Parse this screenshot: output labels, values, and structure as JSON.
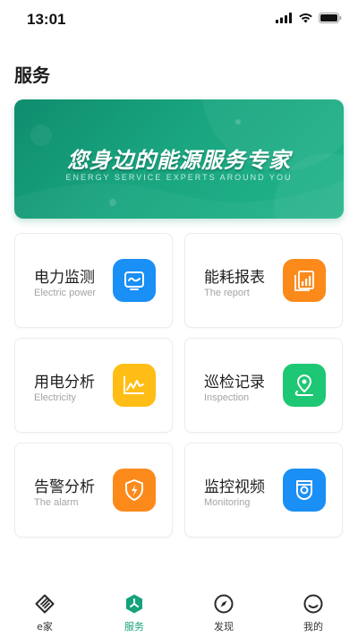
{
  "status_bar": {
    "time": "13:01"
  },
  "page": {
    "title": "服务"
  },
  "banner": {
    "title": "您身边的能源服务专家",
    "subtitle": "ENERGY SERVICE EXPERTS AROUND YOU"
  },
  "cards": [
    {
      "title": "电力监测",
      "subtitle": "Electric power",
      "icon": "monitor-wave-icon",
      "color": "#1a8ff5"
    },
    {
      "title": "能耗报表",
      "subtitle": "The report",
      "icon": "report-chart-icon",
      "color": "#fb8a1b"
    },
    {
      "title": "用电分析",
      "subtitle": "Electricity",
      "icon": "analysis-chart-icon",
      "color": "#ffbd15"
    },
    {
      "title": "巡检记录",
      "subtitle": "Inspection",
      "icon": "location-pin-icon",
      "color": "#1ec773"
    },
    {
      "title": "告警分析",
      "subtitle": "The alarm",
      "icon": "shield-lightning-icon",
      "color": "#fb8a1b"
    },
    {
      "title": "监控视频",
      "subtitle": "Monitoring",
      "icon": "camera-icon",
      "color": "#1a8ff5"
    }
  ],
  "tabs": [
    {
      "label": "e家",
      "icon": "e-home-icon",
      "active": false
    },
    {
      "label": "服务",
      "icon": "service-hex-icon",
      "active": true
    },
    {
      "label": "发现",
      "icon": "compass-icon",
      "active": false
    },
    {
      "label": "我的",
      "icon": "profile-face-icon",
      "active": false
    }
  ],
  "colors": {
    "accent": "#15a27c",
    "banner": "#18a27c"
  }
}
